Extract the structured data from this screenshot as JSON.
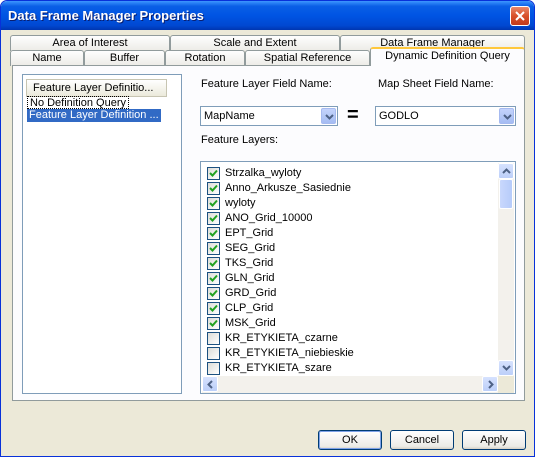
{
  "window": {
    "title": "Data Frame Manager Properties"
  },
  "tabs": {
    "row1": [
      "Area of Interest",
      "Scale and Extent",
      "Data Frame Manager"
    ],
    "row2": [
      "Name",
      "Buffer",
      "Rotation",
      "Spatial Reference",
      "Dynamic Definition Query"
    ],
    "active": "Dynamic Definition Query"
  },
  "definition_list": {
    "header": "Feature Layer Definitio...",
    "items": [
      "No Definition Query",
      "Feature Layer Definition ..."
    ],
    "selected_index": 1
  },
  "fields": {
    "layer_field_label": "Feature Layer Field Name:",
    "layer_field_value": "MapName",
    "equals": "=",
    "map_sheet_label": "Map Sheet Field Name:",
    "map_sheet_value": "GODLO"
  },
  "feature_layers": {
    "label": "Feature Layers:",
    "items": [
      {
        "name": "Strzalka_wyloty",
        "checked": true
      },
      {
        "name": "Anno_Arkusze_Sasiednie",
        "checked": true
      },
      {
        "name": "wyloty",
        "checked": true
      },
      {
        "name": "ANO_Grid_10000",
        "checked": true
      },
      {
        "name": "EPT_Grid",
        "checked": true
      },
      {
        "name": "SEG_Grid",
        "checked": true
      },
      {
        "name": "TKS_Grid",
        "checked": true
      },
      {
        "name": "GLN_Grid",
        "checked": true
      },
      {
        "name": "GRD_Grid",
        "checked": true
      },
      {
        "name": "CLP_Grid",
        "checked": true
      },
      {
        "name": "MSK_Grid",
        "checked": true
      },
      {
        "name": "KR_ETYKIETA_czarne",
        "checked": false
      },
      {
        "name": "KR_ETYKIETA_niebieskie",
        "checked": false
      },
      {
        "name": "KR_ETYKIETA_szare",
        "checked": false
      }
    ]
  },
  "buttons": {
    "ok": "OK",
    "cancel": "Cancel",
    "apply": "Apply"
  }
}
